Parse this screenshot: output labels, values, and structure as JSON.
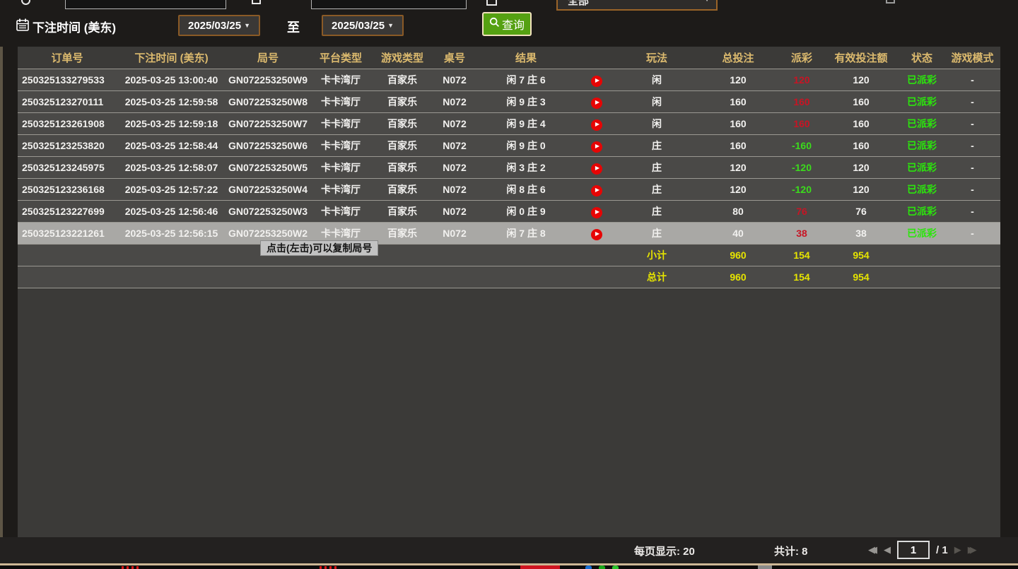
{
  "filters": {
    "bet_time_label": "下注时间 (美东)",
    "from_date": "2025/03/25",
    "to_label": "至",
    "to_date": "2025/03/25",
    "query_label": "查询",
    "top_dropdown_value": "全部",
    "caret": "▼"
  },
  "table": {
    "headers": [
      "订单号",
      "下注时间 (美东)",
      "局号",
      "平台类型",
      "游戏类型",
      "桌号",
      "结果",
      "",
      "玩法",
      "总投注",
      "派彩",
      "有效投注额",
      "状态",
      "游戏模式"
    ],
    "rows": [
      {
        "order_id": "250325133279533",
        "bet_time": "2025-03-25 13:00:40",
        "round_id": "GN072253250W9",
        "platform": "卡卡湾厅",
        "game_type": "百家乐",
        "table_no": "N072",
        "result": "闲 7 庄 6",
        "play": "闲",
        "total_bet": "120",
        "payout": "120",
        "payout_color": "red",
        "valid_bet": "120",
        "status": "已派彩",
        "game_mode": "-",
        "highlight": false
      },
      {
        "order_id": "250325123270111",
        "bet_time": "2025-03-25 12:59:58",
        "round_id": "GN072253250W8",
        "platform": "卡卡湾厅",
        "game_type": "百家乐",
        "table_no": "N072",
        "result": "闲 9 庄 3",
        "play": "闲",
        "total_bet": "160",
        "payout": "160",
        "payout_color": "red",
        "valid_bet": "160",
        "status": "已派彩",
        "game_mode": "-",
        "highlight": false
      },
      {
        "order_id": "250325123261908",
        "bet_time": "2025-03-25 12:59:18",
        "round_id": "GN072253250W7",
        "platform": "卡卡湾厅",
        "game_type": "百家乐",
        "table_no": "N072",
        "result": "闲 9 庄 4",
        "play": "闲",
        "total_bet": "160",
        "payout": "160",
        "payout_color": "red",
        "valid_bet": "160",
        "status": "已派彩",
        "game_mode": "-",
        "highlight": false
      },
      {
        "order_id": "250325123253820",
        "bet_time": "2025-03-25 12:58:44",
        "round_id": "GN072253250W6",
        "platform": "卡卡湾厅",
        "game_type": "百家乐",
        "table_no": "N072",
        "result": "闲 9 庄 0",
        "play": "庄",
        "total_bet": "160",
        "payout": "-160",
        "payout_color": "green",
        "valid_bet": "160",
        "status": "已派彩",
        "game_mode": "-",
        "highlight": false
      },
      {
        "order_id": "250325123245975",
        "bet_time": "2025-03-25 12:58:07",
        "round_id": "GN072253250W5",
        "platform": "卡卡湾厅",
        "game_type": "百家乐",
        "table_no": "N072",
        "result": "闲 3 庄 2",
        "play": "庄",
        "total_bet": "120",
        "payout": "-120",
        "payout_color": "green",
        "valid_bet": "120",
        "status": "已派彩",
        "game_mode": "-",
        "highlight": false
      },
      {
        "order_id": "250325123236168",
        "bet_time": "2025-03-25 12:57:22",
        "round_id": "GN072253250W4",
        "platform": "卡卡湾厅",
        "game_type": "百家乐",
        "table_no": "N072",
        "result": "闲 8 庄 6",
        "play": "庄",
        "total_bet": "120",
        "payout": "-120",
        "payout_color": "green",
        "valid_bet": "120",
        "status": "已派彩",
        "game_mode": "-",
        "highlight": false
      },
      {
        "order_id": "250325123227699",
        "bet_time": "2025-03-25 12:56:46",
        "round_id": "GN072253250W3",
        "platform": "卡卡湾厅",
        "game_type": "百家乐",
        "table_no": "N072",
        "result": "闲 0 庄 9",
        "play": "庄",
        "total_bet": "80",
        "payout": "76",
        "payout_color": "red",
        "valid_bet": "76",
        "status": "已派彩",
        "game_mode": "-",
        "highlight": false
      },
      {
        "order_id": "250325123221261",
        "bet_time": "2025-03-25 12:56:15",
        "round_id": "GN072253250W2",
        "platform": "卡卡湾厅",
        "game_type": "百家乐",
        "table_no": "N072",
        "result": "闲 7 庄 8",
        "play": "庄",
        "total_bet": "40",
        "payout": "38",
        "payout_color": "red",
        "valid_bet": "38",
        "status": "已派彩",
        "game_mode": "-",
        "highlight": true
      }
    ],
    "subtotal": {
      "label": "小计",
      "total_bet": "960",
      "payout": "154",
      "valid_bet": "954"
    },
    "total": {
      "label": "总计",
      "total_bet": "960",
      "payout": "154",
      "valid_bet": "954"
    }
  },
  "tooltip": {
    "text": "点击(左击)可以复制局号"
  },
  "footer": {
    "per_page": "每页显示: 20",
    "total_count": "共计: 8",
    "page": "1",
    "of": "/ 1",
    "first_icon": "◀◀",
    "prev_icon": "◀",
    "next_icon": "▶",
    "last_icon": "▶▶"
  },
  "icons": [
    "calendar-icon",
    "search-icon",
    "replay-icon",
    "chevron-down-icon"
  ],
  "colors": {
    "header_text": "#dcba6e",
    "win_red": "#c81424",
    "loss_green": "#3bdc1c",
    "status_green": "#2be60c",
    "totals_yellow": "#e6e400",
    "query_green": "#55a112",
    "date_border": "#8a5a26",
    "highlight_row": "#a9a8a5"
  }
}
